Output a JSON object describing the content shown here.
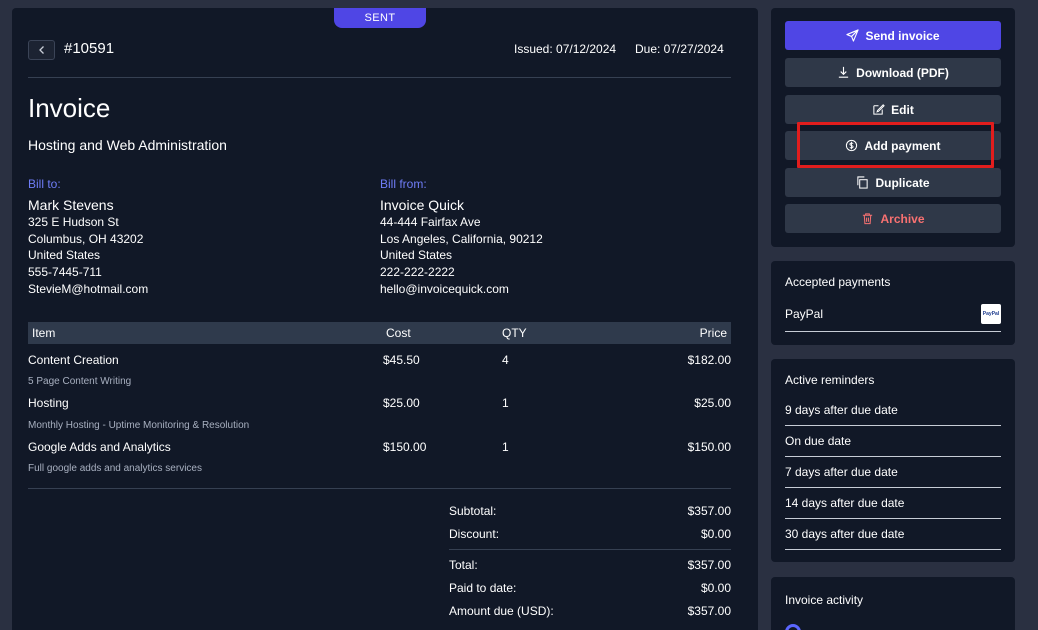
{
  "invoice": {
    "status": "SENT",
    "number": "#10591",
    "issued": "Issued: 07/12/2024",
    "due": "Due: 07/27/2024",
    "title": "Invoice",
    "subtitle": "Hosting and Web Administration",
    "bill_to": {
      "label": "Bill to:",
      "name": "Mark Stevens",
      "street": "325 E Hudson St",
      "city": "Columbus, OH 43202",
      "country": "United States",
      "phone": "555-7445-711",
      "email": "StevieM@hotmail.com"
    },
    "bill_from": {
      "label": "Bill from:",
      "name": "Invoice Quick",
      "street": "44-444 Fairfax Ave",
      "city": "Los Angeles, California, 90212",
      "country": "United States",
      "phone": "222-222-2222",
      "email": "hello@invoicequick.com"
    },
    "columns": {
      "item": "Item",
      "cost": "Cost",
      "qty": "QTY",
      "price": "Price"
    },
    "items": [
      {
        "name": "Content Creation",
        "description": "5 Page Content Writing",
        "cost": "$45.50",
        "qty": "4",
        "price": "$182.00"
      },
      {
        "name": "Hosting",
        "description": "Monthly Hosting - Uptime Monitoring & Resolution",
        "cost": "$25.00",
        "qty": "1",
        "price": "$25.00"
      },
      {
        "name": "Google Adds and Analytics",
        "description": "Full google adds and analytics services",
        "cost": "$150.00",
        "qty": "1",
        "price": "$150.00"
      }
    ],
    "totals": {
      "subtotal_label": "Subtotal:",
      "subtotal": "$357.00",
      "discount_label": "Discount:",
      "discount": "$0.00",
      "total_label": "Total:",
      "total": "$357.00",
      "paid_label": "Paid to date:",
      "paid": "$0.00",
      "amount_due_label": "Amount due (USD):",
      "amount_due": "$357.00"
    }
  },
  "actions": {
    "send": "Send invoice",
    "download": "Download (PDF)",
    "edit": "Edit",
    "add_payment": "Add payment",
    "duplicate": "Duplicate",
    "archive": "Archive"
  },
  "payments": {
    "title": "Accepted payments",
    "method": "PayPal",
    "logo_text": "PayPal"
  },
  "reminders": {
    "title": "Active reminders",
    "items": [
      "9 days after due date",
      "On due date",
      "7 days after due date",
      "14 days after due date",
      "30 days after due date"
    ]
  },
  "activity": {
    "title": "Invoice activity"
  },
  "colors": {
    "accent": "#4f46e5",
    "danger": "#f87171",
    "highlight": "#e11d1d",
    "panel": "#111827",
    "background": "#2a3041"
  },
  "icons": [
    "chevron-left-icon",
    "send-icon",
    "download-icon",
    "edit-icon",
    "dollar-circle-icon",
    "copy-icon",
    "trash-icon",
    "paypal-logo-icon"
  ]
}
